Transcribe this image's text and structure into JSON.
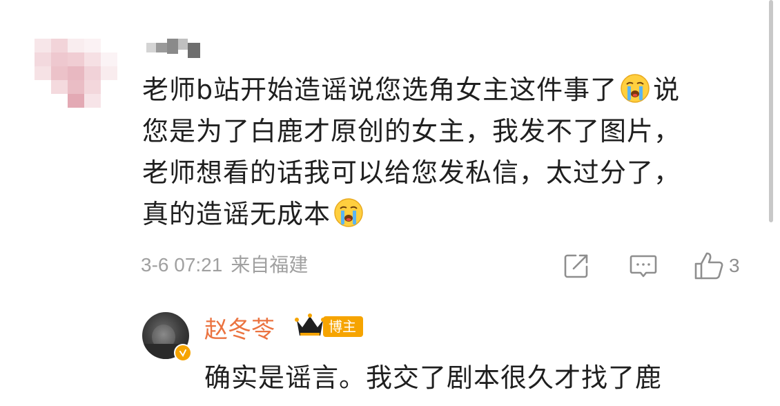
{
  "comment": {
    "line1_a": "老师b站开始造谣说您选角女主这件事了",
    "line1_b": "说",
    "line2": "您是为了白鹿才原创的女主，我发不了图片，",
    "line3": "老师想看的话我可以给您发私信，太过分了，",
    "line4": "真的造谣无成本",
    "emoji_name": "crying-face-icon",
    "date": "3-6 07:21",
    "location": "来自福建",
    "like_count": "3"
  },
  "reply": {
    "author": "赵冬苓",
    "badge": "博主",
    "text": "确实是谣言。我交了剧本很久才找了鹿"
  },
  "colors": {
    "reply_author": "#eb7340",
    "badge_bg": "#f6a400",
    "meta_text": "#a0a0a0",
    "body_text": "#1f1f1f"
  }
}
